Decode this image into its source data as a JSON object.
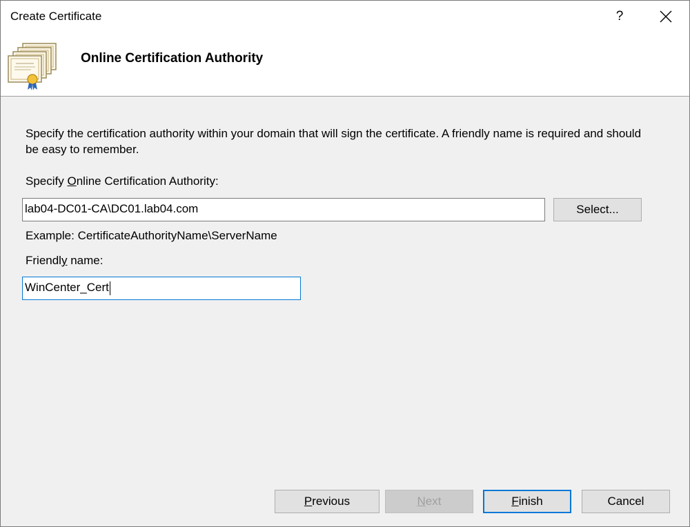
{
  "window": {
    "title": "Create Certificate",
    "help_label": "?"
  },
  "header": {
    "title": "Online Certification Authority",
    "icon": "certificate-stack-icon"
  },
  "content": {
    "description": "Specify the certification authority within your domain that will sign the certificate. A friendly name is required and should be easy to remember.",
    "ca_label": {
      "pre": "Specify ",
      "key": "O",
      "post": "nline Certification Authority:"
    },
    "ca_value": "lab04-DC01-CA\\DC01.lab04.com",
    "select_button": "Select...",
    "example": "Example: CertificateAuthorityName\\ServerName",
    "friendly_label": {
      "pre": "Friendl",
      "key": "y",
      "post": " name:"
    },
    "friendly_value": "WinCenter_Cert"
  },
  "footer": {
    "previous": {
      "key": "P",
      "rest": "revious"
    },
    "next": {
      "key": "N",
      "rest": "ext"
    },
    "finish": {
      "key": "F",
      "rest": "inish"
    },
    "cancel": "Cancel"
  },
  "colors": {
    "focus": "#0078d7",
    "dialog_bg": "#f0f0f0"
  }
}
